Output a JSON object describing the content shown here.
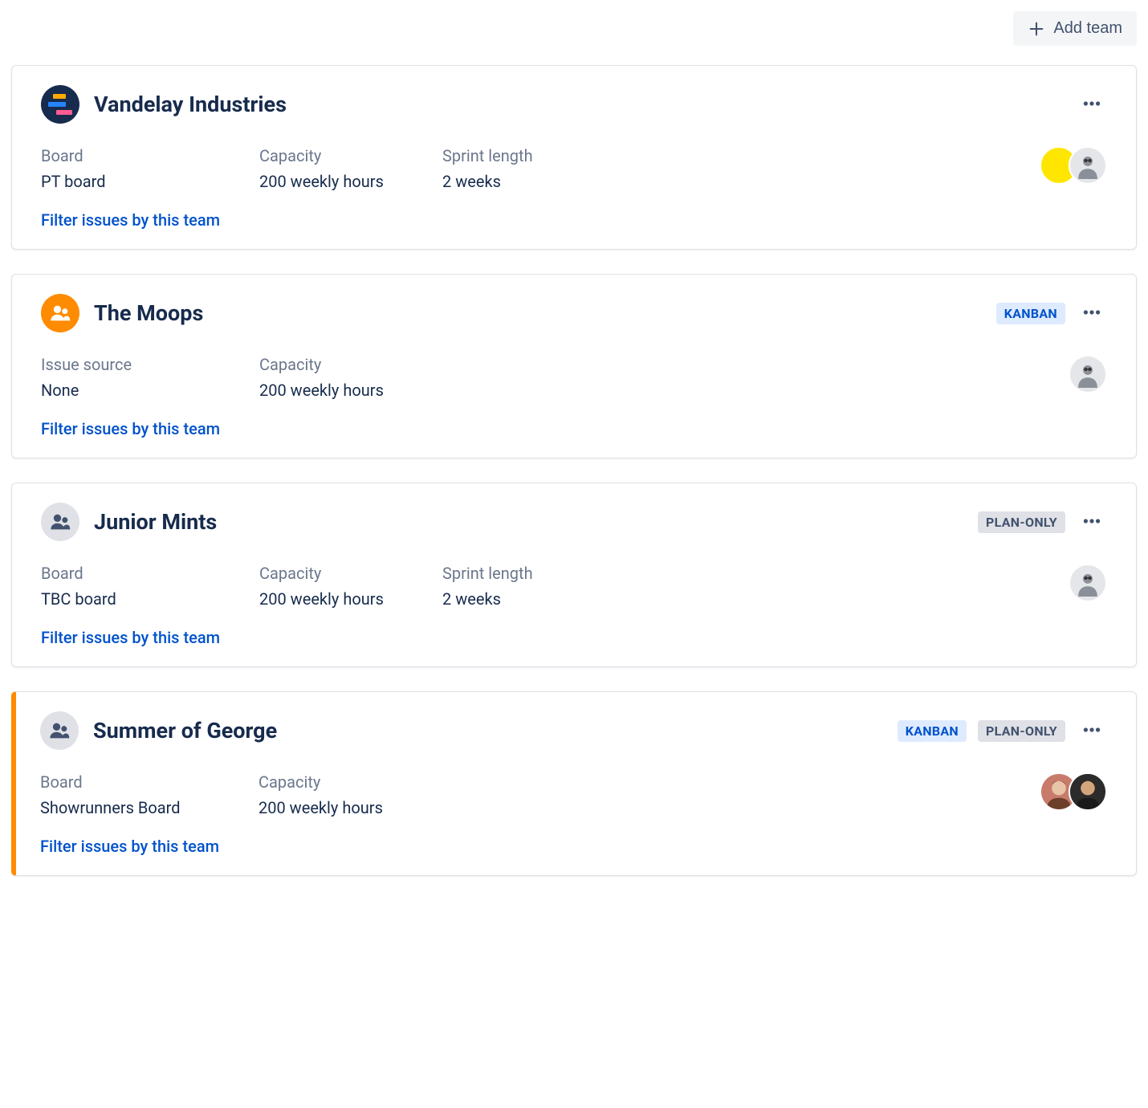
{
  "toolbar": {
    "add_team_label": "Add team"
  },
  "filter_link_label": "Filter issues by this team",
  "field_labels": {
    "board": "Board",
    "capacity": "Capacity",
    "sprint_length": "Sprint length",
    "issue_source": "Issue source"
  },
  "badges": {
    "kanban": "KANBAN",
    "plan_only": "PLAN-ONLY"
  },
  "teams": [
    {
      "name": "Vandelay Industries",
      "avatar_type": "project",
      "badges": [],
      "fields": [
        {
          "label_key": "board",
          "value": "PT board"
        },
        {
          "label_key": "capacity",
          "value": "200 weekly hours"
        },
        {
          "label_key": "sprint_length",
          "value": "2 weeks"
        }
      ],
      "members": [
        "yellow",
        "photo1"
      ],
      "stripe": false
    },
    {
      "name": "The Moops",
      "avatar_type": "people_orange",
      "badges": [
        "kanban"
      ],
      "fields": [
        {
          "label_key": "issue_source",
          "value": "None"
        },
        {
          "label_key": "capacity",
          "value": "200 weekly hours"
        }
      ],
      "members": [
        "photo1"
      ],
      "stripe": false
    },
    {
      "name": "Junior Mints",
      "avatar_type": "people_gray",
      "badges": [
        "plan_only"
      ],
      "fields": [
        {
          "label_key": "board",
          "value": "TBC board"
        },
        {
          "label_key": "capacity",
          "value": "200 weekly hours"
        },
        {
          "label_key": "sprint_length",
          "value": "2 weeks"
        }
      ],
      "members": [
        "photo1"
      ],
      "stripe": false
    },
    {
      "name": "Summer of George",
      "avatar_type": "people_gray",
      "badges": [
        "kanban",
        "plan_only"
      ],
      "fields": [
        {
          "label_key": "board",
          "value": "Showrunners Board"
        },
        {
          "label_key": "capacity",
          "value": "200 weekly hours"
        }
      ],
      "members": [
        "photo2",
        "photo3"
      ],
      "stripe": true
    }
  ]
}
